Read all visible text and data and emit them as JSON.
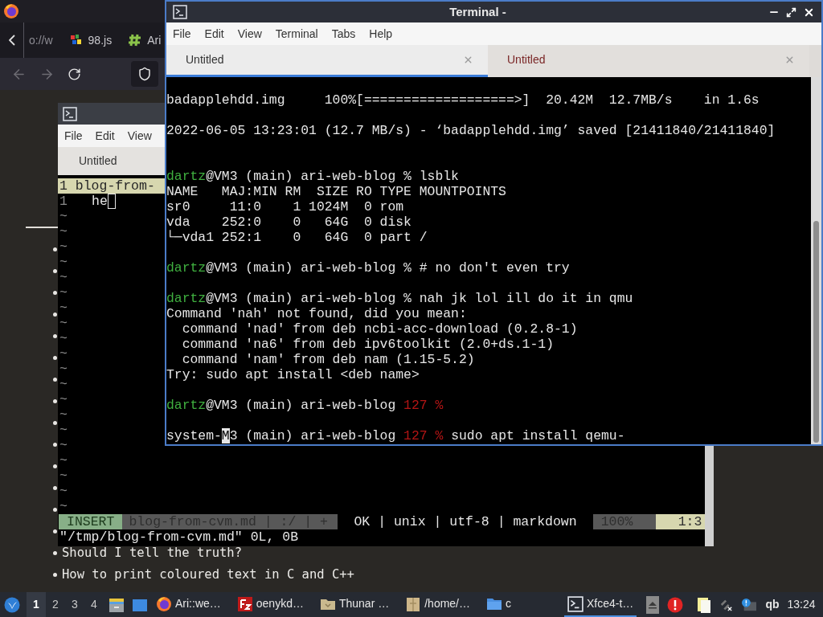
{
  "browser": {
    "tabs": [
      {
        "label": "o://w",
        "kind": "url"
      },
      {
        "label": "98.js",
        "kind": "pixel"
      },
      {
        "label": "Ari",
        "kind": "hash"
      }
    ],
    "page_list": [
      {
        "kind": "covered"
      },
      {
        "kind": "covered"
      },
      {
        "kind": "covered"
      },
      {
        "kind": "covered"
      },
      {
        "kind": "covered"
      },
      {
        "kind": "covered"
      },
      {
        "kind": "covered"
      },
      {
        "kind": "covered"
      },
      {
        "kind": "covered"
      },
      {
        "kind": "covered"
      },
      {
        "kind": "covered"
      },
      {
        "kind": "covered"
      },
      {
        "kind": "covered"
      },
      {
        "kind": "covered"
      },
      {
        "kind": "visible",
        "text": "Should I tell the truth?"
      },
      {
        "kind": "visible",
        "text": "How to print coloured text in C and C++"
      }
    ]
  },
  "vim_window": {
    "menu": [
      "File",
      "Edit",
      "View"
    ],
    "tab": "Untitled",
    "tabline": "1 blog-from-",
    "line_number": "1",
    "line_text": "he",
    "filler": [
      "~",
      "~",
      "~",
      "~",
      "~",
      "~",
      "~",
      "~",
      "~",
      "~",
      "~",
      "~",
      "~",
      "~",
      "~",
      "~",
      "~",
      "~",
      "~",
      "~"
    ],
    "status": {
      "mode": "INSERT",
      "file": "blog-from-cvm.md | :/ | +",
      "info": "OK | unix | utf-8 | markdown",
      "percent": "100%",
      "position": "1:3"
    },
    "message": "\"/tmp/blog-from-cvm.md\" 0L, 0B"
  },
  "terminal": {
    "title": "Terminal -",
    "menu": [
      "File",
      "Edit",
      "View",
      "Terminal",
      "Tabs",
      "Help"
    ],
    "tabs": [
      {
        "label": "Untitled",
        "selected": true
      },
      {
        "label": "Untitled",
        "selected": false
      }
    ],
    "lines": [
      {
        "kind": "text",
        "segments": [
          {
            "kind": "plain",
            "text": "badapplehdd.img     100%[===================>]  20.42M  12.7MB/s    in 1.6s"
          }
        ]
      },
      {
        "kind": "blank"
      },
      {
        "kind": "text",
        "segments": [
          {
            "kind": "plain",
            "text": "2022-06-05 13:23:01 (12.7 MB/s) - ‘badapplehdd.img’ saved [21411840/21411840]"
          }
        ]
      },
      {
        "kind": "blank"
      },
      {
        "kind": "blank"
      },
      {
        "kind": "text",
        "segments": [
          {
            "kind": "user",
            "text": "dartz"
          },
          {
            "kind": "plain",
            "text": "@VM3 (main) ari-web-blog % lsblk"
          }
        ]
      },
      {
        "kind": "text",
        "segments": [
          {
            "kind": "plain",
            "text": "NAME   MAJ:MIN RM  SIZE RO TYPE MOUNTPOINTS"
          }
        ]
      },
      {
        "kind": "text",
        "segments": [
          {
            "kind": "plain",
            "text": "sr0     11:0    1 1024M  0 rom"
          }
        ]
      },
      {
        "kind": "text",
        "segments": [
          {
            "kind": "plain",
            "text": "vda    252:0    0   64G  0 disk"
          }
        ]
      },
      {
        "kind": "text",
        "segments": [
          {
            "kind": "plain",
            "text": "└─vda1 252:1    0   64G  0 part /"
          }
        ]
      },
      {
        "kind": "blank"
      },
      {
        "kind": "text",
        "segments": [
          {
            "kind": "user",
            "text": "dartz"
          },
          {
            "kind": "plain",
            "text": "@VM3 (main) ari-web-blog % # no don't even try"
          }
        ]
      },
      {
        "kind": "blank"
      },
      {
        "kind": "text",
        "segments": [
          {
            "kind": "user",
            "text": "dartz"
          },
          {
            "kind": "plain",
            "text": "@VM3 (main) ari-web-blog % nah jk lol ill do it in qmu"
          }
        ]
      },
      {
        "kind": "text",
        "segments": [
          {
            "kind": "plain",
            "text": "Command 'nah' not found, did you mean:"
          }
        ]
      },
      {
        "kind": "text",
        "segments": [
          {
            "kind": "plain",
            "text": "  command 'nad' from deb ncbi-acc-download (0.2.8-1)"
          }
        ]
      },
      {
        "kind": "text",
        "segments": [
          {
            "kind": "plain",
            "text": "  command 'na6' from deb ipv6toolkit (2.0+ds.1-1)"
          }
        ]
      },
      {
        "kind": "text",
        "segments": [
          {
            "kind": "plain",
            "text": "  command 'nam' from deb nam (1.15-5.2)"
          }
        ]
      },
      {
        "kind": "text",
        "segments": [
          {
            "kind": "plain",
            "text": "Try: sudo apt install <deb name>"
          }
        ]
      },
      {
        "kind": "blank"
      },
      {
        "kind": "text",
        "segments": [
          {
            "kind": "user",
            "text": "dartz"
          },
          {
            "kind": "plain",
            "text": "@VM3 (main) ari-web-blog "
          },
          {
            "kind": "error",
            "text": "127 %"
          }
        ]
      },
      {
        "kind": "blank"
      },
      {
        "kind": "text",
        "segments": [
          {
            "kind": "plain",
            "text": "system-"
          },
          {
            "kind": "cursor",
            "text": "M"
          },
          {
            "kind": "plain",
            "text": "3 (main) ari-web-blog "
          },
          {
            "kind": "error",
            "text": "127 %"
          },
          {
            "kind": "plain",
            "text": " sudo apt install qemu-"
          }
        ]
      }
    ]
  },
  "taskbar": {
    "workspaces": [
      {
        "label": "1",
        "selected": true
      },
      {
        "label": "2",
        "selected": false
      },
      {
        "label": "3",
        "selected": false
      },
      {
        "label": "4",
        "selected": false
      }
    ],
    "tasks": [
      {
        "kind": "firefox",
        "label": "Ari::we…",
        "active": false
      },
      {
        "kind": "filezilla",
        "label": "oenykd…",
        "active": false
      },
      {
        "kind": "thunar",
        "label": "Thunar …",
        "active": false
      },
      {
        "kind": "archive",
        "label": "/home/…",
        "active": false
      },
      {
        "kind": "folder",
        "label": "c",
        "active": false
      },
      {
        "kind": "terminal",
        "label": "Xfce4-t…",
        "active": true
      }
    ],
    "tray_label": "qb",
    "clock": "13:24"
  }
}
